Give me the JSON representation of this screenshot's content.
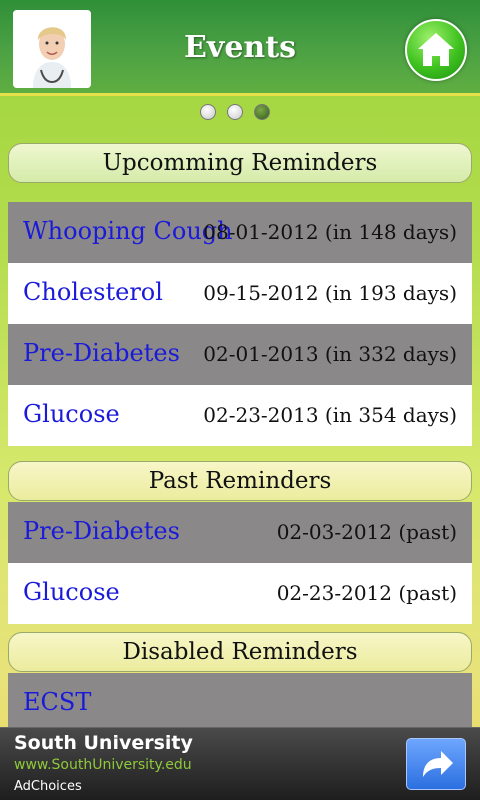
{
  "header": {
    "title": "Events",
    "avatar_icon": "doctor-avatar-icon",
    "home_icon": "home-icon"
  },
  "pager": {
    "count": 3,
    "active_index": 2
  },
  "sections": {
    "upcoming": {
      "title": "Upcomming Reminders",
      "items": [
        {
          "name": "Whooping Cough",
          "date": "08-01-2012 (in 148 days)"
        },
        {
          "name": "Cholesterol",
          "date": "09-15-2012 (in 193 days)"
        },
        {
          "name": "Pre-Diabetes",
          "date": "02-01-2013 (in 332 days)"
        },
        {
          "name": "Glucose",
          "date": "02-23-2013 (in 354 days)"
        }
      ]
    },
    "past": {
      "title": "Past Reminders",
      "items": [
        {
          "name": "Pre-Diabetes",
          "date": "02-03-2012 (past)"
        },
        {
          "name": "Glucose",
          "date": "02-23-2012 (past)"
        }
      ]
    },
    "disabled": {
      "title": "Disabled Reminders",
      "items": [
        {
          "name": "ECST",
          "date": ""
        }
      ]
    }
  },
  "ad": {
    "title": "South University",
    "url": "www.SouthUniversity.edu",
    "choices": "AdChoices",
    "button_icon": "share-arrow-icon"
  },
  "colors": {
    "header_green": "#3d9a3e",
    "row_gray": "#8b8889",
    "link_blue": "#1a1adb",
    "background_lime": "#b4dc4e"
  }
}
